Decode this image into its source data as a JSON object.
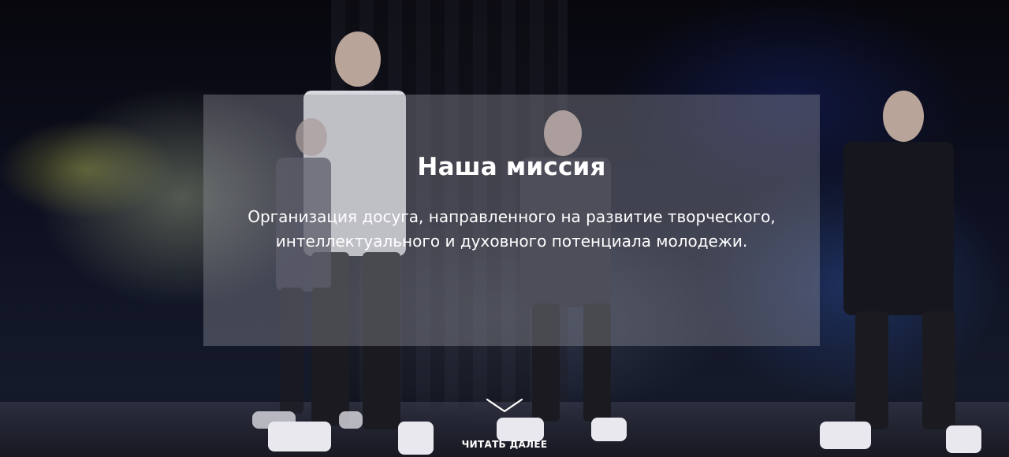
{
  "hero": {
    "background_image": "stage-performers-photo",
    "mission": {
      "title": "Наша миссия",
      "text": "Организация досуга, направленного на развитие творческого, интеллектуального и духовного потенциала молодежи."
    },
    "read_more": {
      "icon": "chevron-down-icon",
      "label": "ЧИТАТЬ ДАЛЕЕ"
    }
  },
  "colors": {
    "text": "#ffffff",
    "overlay": "rgba(150,150,160,0.38)"
  }
}
